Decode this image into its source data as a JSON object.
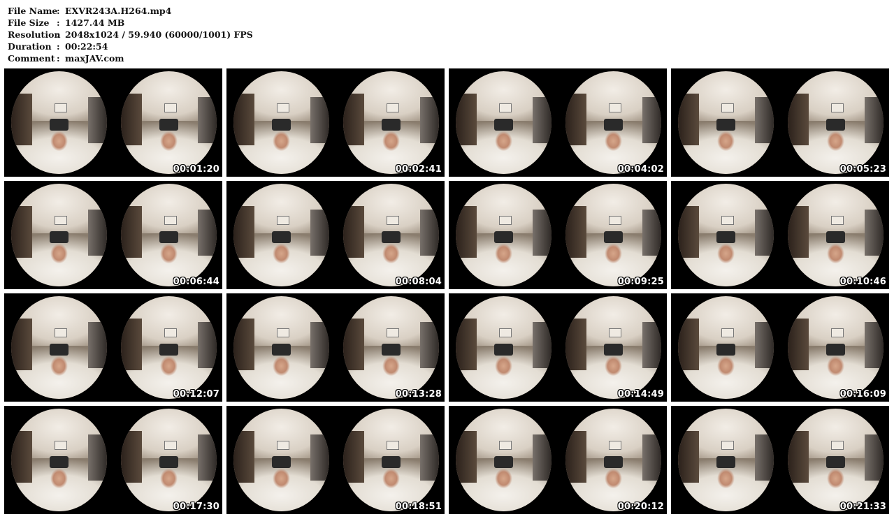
{
  "file_info": [
    {
      "label": "File Name",
      "sep": ":",
      "value": "EXVR243A.H264.mp4"
    },
    {
      "label": "File Size",
      "sep": ":",
      "value": "1427.44 MB"
    },
    {
      "label": "Resolution",
      "sep": ":",
      "value": "2048x1024 / 59.940 (60000/1001) FPS"
    },
    {
      "label": "Duration",
      "sep": ":",
      "value": "00:22:54"
    },
    {
      "label": "Comment",
      "sep": ":",
      "value": "maxJAV.com"
    }
  ],
  "thumbnails": [
    {
      "timestamp": "00:01:20"
    },
    {
      "timestamp": "00:02:41"
    },
    {
      "timestamp": "00:04:02"
    },
    {
      "timestamp": "00:05:23"
    },
    {
      "timestamp": "00:06:44"
    },
    {
      "timestamp": "00:08:04"
    },
    {
      "timestamp": "00:09:25"
    },
    {
      "timestamp": "00:10:46"
    },
    {
      "timestamp": "00:12:07"
    },
    {
      "timestamp": "00:13:28"
    },
    {
      "timestamp": "00:14:49"
    },
    {
      "timestamp": "00:16:09"
    },
    {
      "timestamp": "00:17:30"
    },
    {
      "timestamp": "00:18:51"
    },
    {
      "timestamp": "00:20:12"
    },
    {
      "timestamp": "00:21:33"
    }
  ]
}
